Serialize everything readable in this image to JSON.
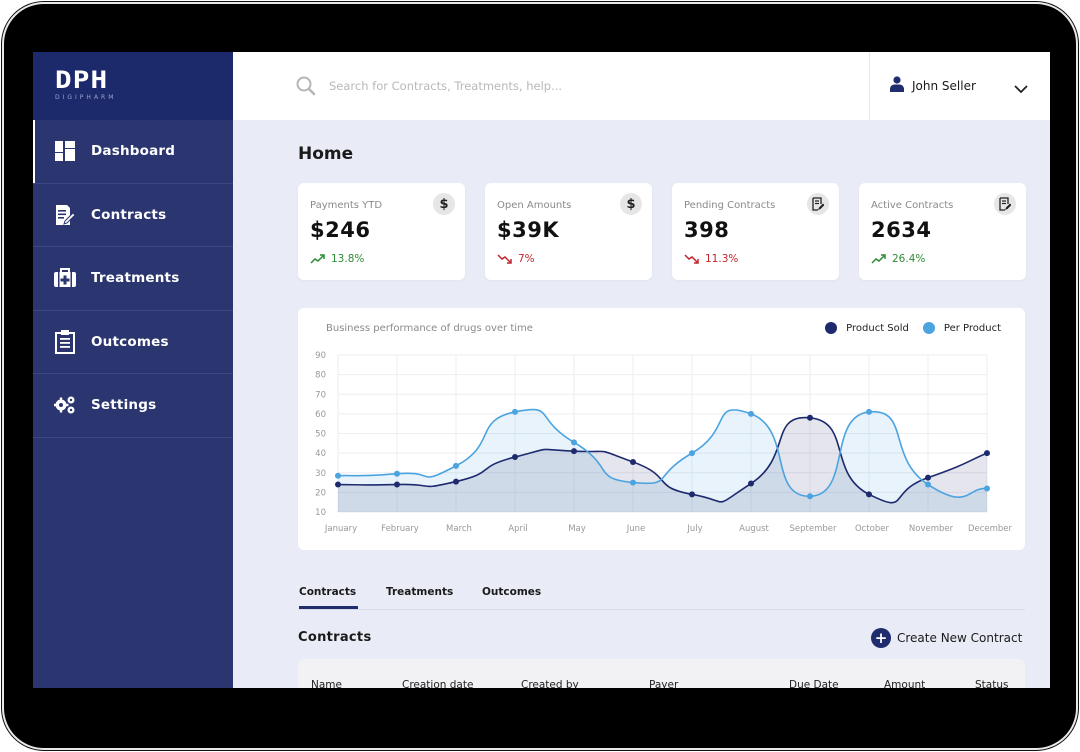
{
  "brand": {
    "logo_text": "DPH",
    "logo_subtext": "DIGIPHARM"
  },
  "sidebar": {
    "items": [
      {
        "label": "Dashboard",
        "icon": "dashboard-grid-icon",
        "active": true
      },
      {
        "label": "Contracts",
        "icon": "contract-edit-icon",
        "active": false
      },
      {
        "label": "Treatments",
        "icon": "medical-kit-icon",
        "active": false
      },
      {
        "label": "Outcomes",
        "icon": "clipboard-icon",
        "active": false
      },
      {
        "label": "Settings",
        "icon": "gears-icon",
        "active": false
      }
    ]
  },
  "topbar": {
    "search_placeholder": "Search for Contracts, Treatments, help...",
    "search_value": "",
    "user_name": "John Seller"
  },
  "page": {
    "title": "Home"
  },
  "kpis": [
    {
      "label": "Payments YTD",
      "value": "$246",
      "delta": "13.8%",
      "trend": "up",
      "icon": "dollar-icon"
    },
    {
      "label": "Open Amounts",
      "value": "$39K",
      "delta": "7%",
      "trend": "down",
      "icon": "dollar-icon"
    },
    {
      "label": "Pending Contracts",
      "value": "398",
      "delta": "11.3%",
      "trend": "down",
      "icon": "document-edit-icon"
    },
    {
      "label": "Active Contracts",
      "value": "2634",
      "delta": "26.4%",
      "trend": "up",
      "icon": "document-edit-icon"
    }
  ],
  "colors": {
    "sidebar": "#2b3670",
    "accent": "#1f2d6e",
    "series_dark": "#1e2a6e",
    "series_light": "#4ba3e0",
    "up": "#2e8b36",
    "down": "#c0262d"
  },
  "chart_data": {
    "type": "area",
    "title": "Business performance of drugs over time",
    "xlabel": "",
    "ylabel": "",
    "categories": [
      "January",
      "February",
      "March",
      "April",
      "May",
      "June",
      "July",
      "August",
      "September",
      "October",
      "November",
      "December"
    ],
    "yticks": [
      10,
      20,
      30,
      40,
      50,
      60,
      70,
      80,
      90
    ],
    "ylim": [
      10,
      90
    ],
    "grid": true,
    "legend_position": "top-right",
    "series": [
      {
        "name": "Product Sold",
        "color": "#1e2a6e",
        "values": [
          24,
          24,
          25.5,
          38,
          41,
          35.5,
          19,
          24.5,
          58,
          19,
          27.5,
          40
        ]
      },
      {
        "name": "Per Product",
        "color": "#4ba3e0",
        "values": [
          28.5,
          29.5,
          33.5,
          61,
          45.5,
          25,
          40,
          60,
          18,
          61,
          24,
          22
        ]
      }
    ]
  },
  "tabs": [
    {
      "label": "Contracts",
      "active": true
    },
    {
      "label": "Treatments",
      "active": false
    },
    {
      "label": "Outcomes",
      "active": false
    }
  ],
  "contracts": {
    "title": "Contracts",
    "create_label": "Create New Contract",
    "columns": [
      "Name",
      "Creation date",
      "Created by",
      "Payer",
      "Due Date",
      "Amount",
      "Status"
    ]
  }
}
